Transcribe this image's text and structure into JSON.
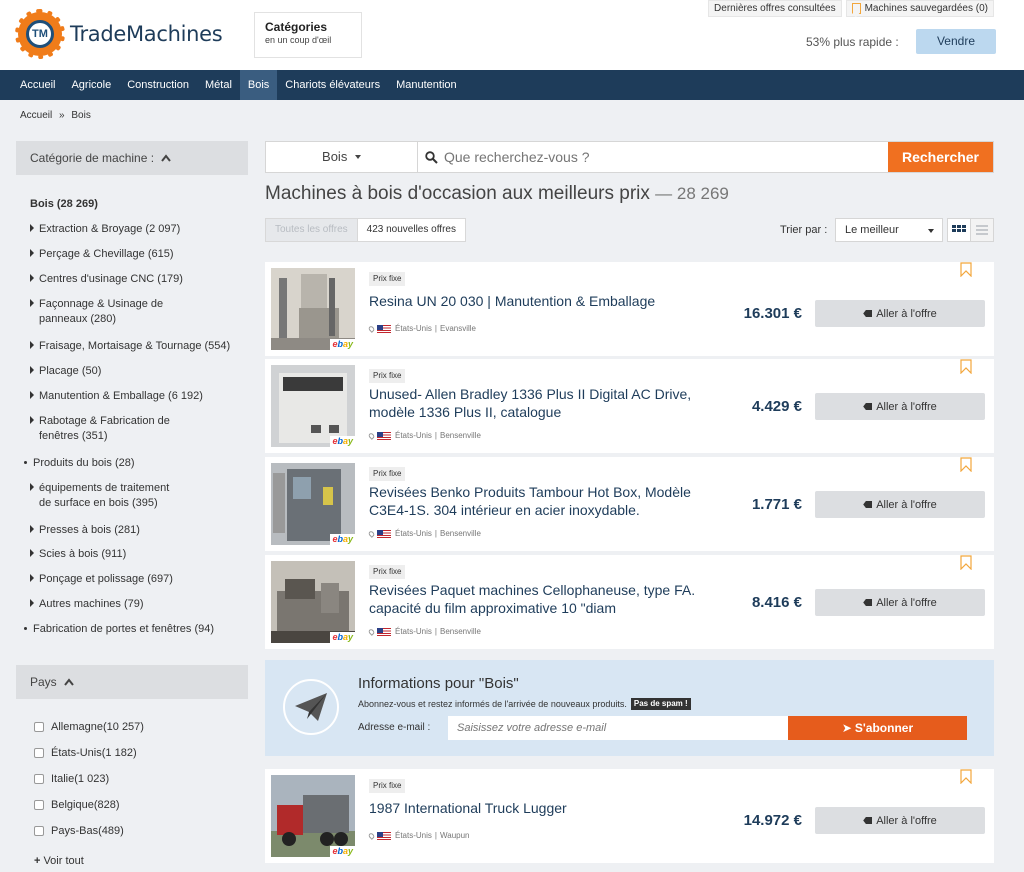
{
  "brand": {
    "name": "TradeMachines",
    "logo_mark": "TM"
  },
  "header": {
    "categories_title": "Catégories",
    "categories_sub": "en un coup d'œil",
    "recent_offers": "Dernières offres consultées",
    "saved_machines": "Machines sauvegardées (0)",
    "faster_text": "53% plus rapide :",
    "sell_label": "Vendre"
  },
  "nav": [
    "Accueil",
    "Agricole",
    "Construction",
    "Métal",
    "Bois",
    "Chariots élévateurs",
    "Manutention"
  ],
  "nav_active": "Bois",
  "breadcrumb": {
    "home": "Accueil",
    "sep": "»",
    "current": "Bois"
  },
  "sidebar": {
    "category_header": "Catégorie de machine :",
    "category_current": "Bois (28 269)",
    "categories": [
      {
        "label": "Extraction & Broyage",
        "count": "(2 097)",
        "kind": "arrow"
      },
      {
        "label": "Perçage & Chevillage",
        "count": "(615)",
        "kind": "arrow"
      },
      {
        "label": "Centres d'usinage CNC",
        "count": "(179)",
        "kind": "arrow"
      },
      {
        "label": "Façonnage & Usinage de panneaux",
        "count": "(280)",
        "kind": "arrow"
      },
      {
        "label": "Fraisage, Mortaisage & Tournage",
        "count": "(554)",
        "kind": "arrow"
      },
      {
        "label": "Placage",
        "count": "(50)",
        "kind": "arrow"
      },
      {
        "label": "Manutention & Emballage",
        "count": "(6 192)",
        "kind": "arrow"
      },
      {
        "label": "Rabotage & Fabrication de fenêtres",
        "count": "(351)",
        "kind": "arrow"
      },
      {
        "label": "Produits du bois",
        "count": "(28)",
        "kind": "dot"
      },
      {
        "label": "équipements de traitement de surface en bois",
        "count": "(395)",
        "kind": "arrow"
      },
      {
        "label": "Presses à bois",
        "count": "(281)",
        "kind": "arrow"
      },
      {
        "label": "Scies à bois",
        "count": "(911)",
        "kind": "arrow"
      },
      {
        "label": "Ponçage et polissage",
        "count": "(697)",
        "kind": "arrow"
      },
      {
        "label": "Autres machines",
        "count": "(79)",
        "kind": "arrow"
      },
      {
        "label": "Fabrication de portes et fenêtres",
        "count": "(94)",
        "kind": "dot"
      }
    ],
    "country_header": "Pays",
    "countries": [
      {
        "label": "Allemagne",
        "count": "(10 257)"
      },
      {
        "label": "États-Unis",
        "count": "(1 182)"
      },
      {
        "label": "Italie",
        "count": "(1 023)"
      },
      {
        "label": "Belgique",
        "count": "(828)"
      },
      {
        "label": "Pays-Bas",
        "count": "(489)"
      }
    ],
    "see_all": "Voir tout"
  },
  "search": {
    "category": "Bois",
    "placeholder": "Que recherchez-vous ?",
    "button": "Rechercher"
  },
  "title": {
    "text": "Machines à bois d'occasion aux meilleurs prix",
    "count": "— 28 269"
  },
  "tabs": {
    "all": "Toutes les offres",
    "new": "423 nouvelles offres"
  },
  "sort": {
    "label": "Trier par :",
    "value": "Le meilleur"
  },
  "listings": [
    {
      "badge": "Prix fixe",
      "title": "Resina UN 20 030 | Manutention & Emballage",
      "country": "États-Unis",
      "city": "Evansville",
      "price": "16.301 €",
      "button": "Aller à l'offre"
    },
    {
      "badge": "Prix fixe",
      "title": "Unused- Allen Bradley 1336 Plus II Digital AC Drive, modèle 1336 Plus II, catalogue",
      "country": "États-Unis",
      "city": "Bensenville",
      "price": "4.429 €",
      "button": "Aller à l'offre"
    },
    {
      "badge": "Prix fixe",
      "title": "Revisées Benko Produits Tambour Hot Box, Modèle C3E4-1S. 304 intérieur en acier inoxydable.",
      "country": "États-Unis",
      "city": "Bensenville",
      "price": "1.771 €",
      "button": "Aller à l'offre"
    },
    {
      "badge": "Prix fixe",
      "title": "Revisées Paquet machines Cellophaneuse, type FA. capacité du film approximative 10 \"diam",
      "country": "États-Unis",
      "city": "Bensenville",
      "price": "8.416 €",
      "button": "Aller à l'offre"
    },
    {
      "badge": "Prix fixe",
      "title": "1987 International Truck Lugger",
      "country": "États-Unis",
      "city": "Waupun",
      "price": "14.972 €",
      "button": "Aller à l'offre"
    }
  ],
  "newsletter": {
    "title": "Informations pour \"Bois\"",
    "subtitle": "Abonnez-vous et restez informés de l'arrivée de nouveaux produits.",
    "spam": "Pas de spam !",
    "email_label": "Adresse e-mail :",
    "email_placeholder": "Saisissez votre adresse e-mail",
    "button": "S'abonner"
  },
  "colors": {
    "navy": "#1e3c5a",
    "orange": "#f07020",
    "sell": "#bcd8ef"
  }
}
